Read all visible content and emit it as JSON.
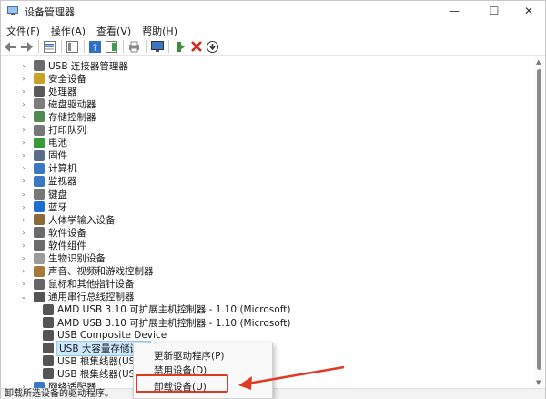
{
  "window": {
    "title": "设备管理器",
    "min_glyph": "—",
    "max_glyph": "☐",
    "close_glyph": "✕"
  },
  "menu": [
    "文件(F)",
    "操作(A)",
    "查看(V)",
    "帮助(H)"
  ],
  "toolbar": {
    "icons": [
      "back-icon",
      "forward-icon",
      "properties-icon",
      "show-hide-tree-icon",
      "help-icon",
      "action-pane-icon",
      "print-icon",
      "monitor-icon",
      "add-driver-icon",
      "uninstall-icon",
      "download-icon"
    ]
  },
  "tree": {
    "categories": [
      {
        "label": "USB 连接器管理器",
        "icon": "usb-connector-icon"
      },
      {
        "label": "安全设备",
        "icon": "security-icon"
      },
      {
        "label": "处理器",
        "icon": "processor-icon"
      },
      {
        "label": "磁盘驱动器",
        "icon": "disk-icon"
      },
      {
        "label": "存储控制器",
        "icon": "storage-icon"
      },
      {
        "label": "打印队列",
        "icon": "printer-icon"
      },
      {
        "label": "电池",
        "icon": "battery-icon"
      },
      {
        "label": "固件",
        "icon": "firmware-icon"
      },
      {
        "label": "计算机",
        "icon": "computer-icon"
      },
      {
        "label": "监视器",
        "icon": "monitor-icon"
      },
      {
        "label": "键盘",
        "icon": "keyboard-icon"
      },
      {
        "label": "蓝牙",
        "icon": "bluetooth-icon"
      },
      {
        "label": "人体学输入设备",
        "icon": "hid-icon"
      },
      {
        "label": "软件设备",
        "icon": "software-device-icon"
      },
      {
        "label": "软件组件",
        "icon": "software-component-icon"
      },
      {
        "label": "生物识别设备",
        "icon": "biometric-icon"
      },
      {
        "label": "声音、视频和游戏控制器",
        "icon": "audio-icon"
      },
      {
        "label": "鼠标和其他指针设备",
        "icon": "mouse-icon"
      }
    ],
    "expanded": {
      "label": "通用串行总线控制器",
      "icon": "usb-icon",
      "children": [
        "AMD USB 3.10 可扩展主机控制器 - 1.10 (Microsoft)",
        "AMD USB 3.10 可扩展主机控制器 - 1.10 (Microsoft)",
        "USB Composite Device",
        "USB 大容量存储设备",
        "USB 根集线器(USB",
        "USB 根集线器(USB"
      ]
    },
    "last": {
      "label": "网络适配器",
      "icon": "network-icon"
    }
  },
  "context_menu": {
    "items": [
      "更新驱动程序(P)",
      "禁用设备(D)",
      "卸载设备(U)"
    ]
  },
  "status": "卸载所选设备的驱动程序。",
  "colors": {
    "highlight_border": "#e23b24",
    "selection_bg": "#cde8ff",
    "arrow": "#e23b24"
  }
}
